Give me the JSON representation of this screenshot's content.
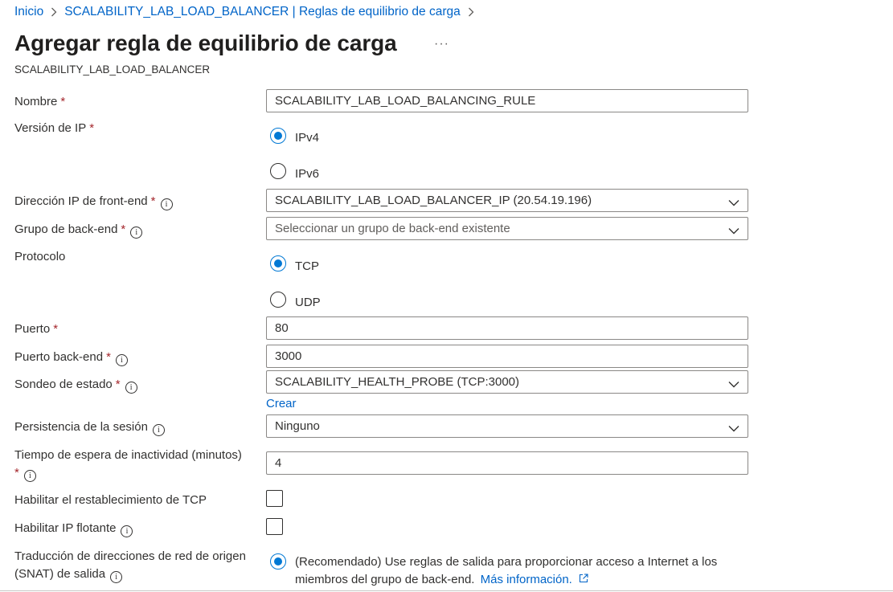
{
  "breadcrumb": {
    "home": "Inicio",
    "parent": "SCALABILITY_LAB_LOAD_BALANCER | Reglas de equilibrio de carga"
  },
  "page": {
    "title": "Agregar regla de equilibrio de carga",
    "more": "···",
    "subtitle": "SCALABILITY_LAB_LOAD_BALANCER"
  },
  "form": {
    "required_mark": "*",
    "info_glyph": "i",
    "name": {
      "label": "Nombre",
      "value": "SCALABILITY_LAB_LOAD_BALANCING_RULE"
    },
    "ip_version": {
      "label": "Versión de IP",
      "options": [
        "IPv4",
        "IPv6"
      ],
      "selected": "IPv4"
    },
    "frontend_ip": {
      "label": "Dirección IP de front-end",
      "value": "SCALABILITY_LAB_LOAD_BALANCER_IP (20.54.19.196)"
    },
    "backend_pool": {
      "label": "Grupo de back-end",
      "placeholder": "Seleccionar un grupo de back-end existente"
    },
    "protocol": {
      "label": "Protocolo",
      "options": [
        "TCP",
        "UDP"
      ],
      "selected": "TCP"
    },
    "port": {
      "label": "Puerto",
      "value": "80"
    },
    "backend_port": {
      "label": "Puerto back-end",
      "value": "3000"
    },
    "health_probe": {
      "label": "Sondeo de estado",
      "value": "SCALABILITY_HEALTH_PROBE (TCP:3000)",
      "create_link": "Crear"
    },
    "session_persistence": {
      "label": "Persistencia de la sesión",
      "value": "Ninguno"
    },
    "idle_timeout": {
      "label": "Tiempo de espera de inactividad (minutos)",
      "value": "4"
    },
    "tcp_reset": {
      "label": "Habilitar el restablecimiento de TCP",
      "checked": false
    },
    "floating_ip": {
      "label": "Habilitar IP flotante",
      "checked": false
    },
    "snat": {
      "label_line1": "Traducción de direcciones de red de origen",
      "label_line2": "(SNAT) de salida",
      "option_text": "(Recomendado) Use reglas de salida para proporcionar acceso a Internet a los miembros del grupo de back-end.",
      "more_info_link": "Más información.",
      "selected": true
    }
  },
  "icons": {
    "breadcrumb_separator": "chevron-right-icon",
    "dropdown": "chevron-down-icon",
    "info": "info-icon",
    "external_link": "external-link-icon"
  },
  "colors": {
    "link": "#0064c8",
    "accent": "#0078d4",
    "required": "#a4262c",
    "border": "#8a8886"
  }
}
